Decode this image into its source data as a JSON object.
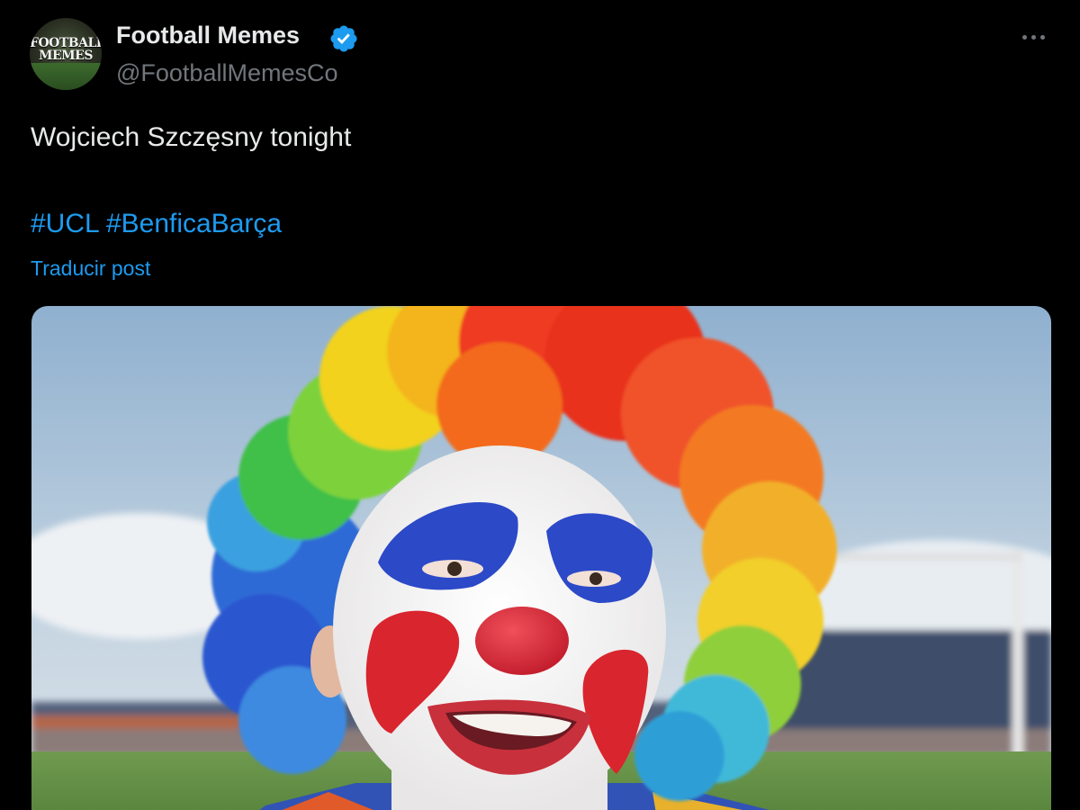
{
  "author": {
    "display_name": "Football Memes",
    "handle": "@FootballMemesCo",
    "avatar_text": [
      "FOOTBALL",
      "MEMES"
    ],
    "verified": true
  },
  "tweet": {
    "text": "Wojciech Szczęsny tonight",
    "hashtags": [
      "#UCL",
      "#BenficaBarça"
    ],
    "translate_label": "Traducir post"
  },
  "media": {
    "description_icon": "photo",
    "type": "image"
  },
  "icons": {
    "verified": "verified-badge-icon",
    "more": "more-options-icon"
  },
  "colors": {
    "background": "#000000",
    "text_primary": "#e7e9ea",
    "text_secondary": "#71767b",
    "accent": "#1d9bf0"
  }
}
